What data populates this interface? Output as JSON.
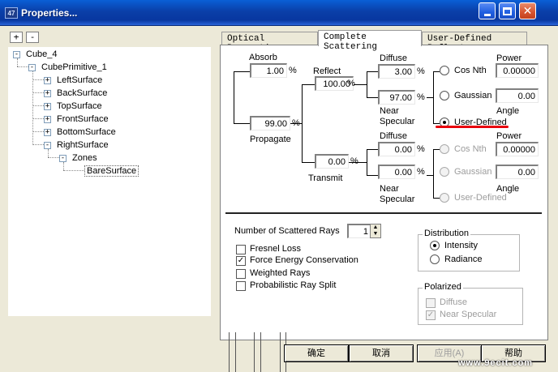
{
  "window": {
    "title": "Properties...",
    "icon_text": "47",
    "minimize_icon": "minimize-icon",
    "maximize_icon": "maximize-icon",
    "close_icon": "close-icon",
    "close_glyph": "✕"
  },
  "tree_toolbar": {
    "expand_label": "+",
    "collapse_label": "-"
  },
  "tree": {
    "items": [
      {
        "label": "Cube_4",
        "toggle": "-"
      },
      {
        "label": "CubePrimitive_1",
        "toggle": "-"
      },
      {
        "label": "LeftSurface",
        "toggle": "+"
      },
      {
        "label": "BackSurface",
        "toggle": "+"
      },
      {
        "label": "TopSurface",
        "toggle": "+"
      },
      {
        "label": "FrontSurface",
        "toggle": "+"
      },
      {
        "label": "BottomSurface",
        "toggle": "+"
      },
      {
        "label": "RightSurface",
        "toggle": "-"
      },
      {
        "label": "Zones",
        "toggle": "-"
      },
      {
        "label": "BareSurface",
        "toggle": ""
      }
    ]
  },
  "tabs": [
    {
      "label": "Optical Properties"
    },
    {
      "label": "Complete Scattering"
    },
    {
      "label": "User-Defined Reflect"
    }
  ],
  "scatter": {
    "absorb_label": "Absorb",
    "absorb_value": "1.00",
    "propagate_value": "99.00",
    "propagate_label": "Propagate",
    "reflect_label": "Reflect",
    "reflect_value": "100.00",
    "transmit_value": "0.00",
    "transmit_label": "Transmit",
    "pct": "%",
    "reflect_branch": {
      "diffuse_label": "Diffuse",
      "diffuse_value": "3.00",
      "specular_value": "97.00",
      "near_label": "Near",
      "specular_label": "Specular",
      "cos_nth_label": "Cos Nth",
      "gaussian_label": "Gaussian",
      "user_defined_label": "User-Defined",
      "power_label": "Power",
      "power_value": "0.00000",
      "angle_value": "0.00",
      "angle_label": "Angle",
      "selected": "User-Defined"
    },
    "transmit_branch": {
      "diffuse_label": "Diffuse",
      "diffuse_value": "0.00",
      "specular_value": "0.00",
      "near_label": "Near",
      "specular_label": "Specular",
      "cos_nth_label": "Cos Nth",
      "gaussian_label": "Gaussian",
      "user_defined_label": "User-Defined",
      "power_label": "Power",
      "power_value": "0.00000",
      "angle_value": "0.00",
      "angle_label": "Angle"
    }
  },
  "options": {
    "rays_label": "Number of Scattered Rays",
    "rays_value": "1",
    "spin_up": "▲",
    "spin_down": "▼",
    "check_mark": "✓",
    "checkboxes": [
      {
        "label": "Fresnel Loss",
        "checked": false
      },
      {
        "label": "Force Energy Conservation",
        "checked": true
      },
      {
        "label": "Weighted Rays",
        "checked": false
      },
      {
        "label": "Probabilistic Ray Split",
        "checked": false
      }
    ],
    "distribution": {
      "legend": "Distribution",
      "intensity_label": "Intensity",
      "radiance_label": "Radiance",
      "selected": "Intensity"
    },
    "polarized": {
      "legend": "Polarized",
      "diffuse_label": "Diffuse",
      "near_specular_label": "Near Specular",
      "diffuse_checked": false,
      "near_specular_checked": true
    }
  },
  "buttons": {
    "ok_label": "确定",
    "cancel_label": "取消",
    "apply_label": "应用(A)",
    "help_label": "帮助"
  },
  "watermark": "www.9ecit.com",
  "colors": {
    "titlebar": "#0a3fa8",
    "annotation_red": "#e8000c",
    "disabled_text": "#9c9c9c"
  }
}
